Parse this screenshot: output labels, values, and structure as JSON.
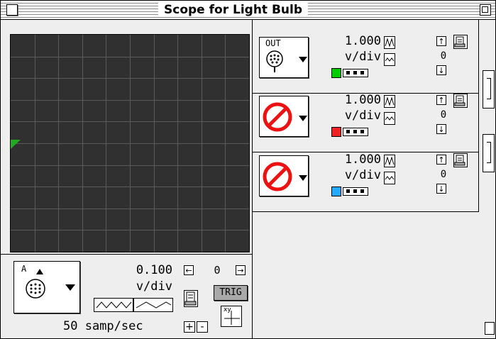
{
  "window": {
    "title": "Scope for Light Bulb"
  },
  "channels": [
    {
      "source_label": "OUT",
      "source_icon": "probe-icon",
      "volts_value": "1.000",
      "volts_unit": "v/div",
      "offset": "0",
      "color": "#00cc00"
    },
    {
      "source_label": "",
      "source_icon": "no-signal-icon",
      "volts_value": "1.000",
      "volts_unit": "v/div",
      "offset": "0",
      "color": "#ee2222"
    },
    {
      "source_label": "",
      "source_icon": "no-signal-icon",
      "volts_value": "1.000",
      "volts_unit": "v/div",
      "offset": "0",
      "color": "#22aaff"
    }
  ],
  "timebase": {
    "source_label": "A",
    "value": "0.100",
    "unit": "v/div",
    "offset": "0",
    "trig_label": "TRIG",
    "xy_label": "xy",
    "sample_rate": "50 samp/sec",
    "plus_label": "+",
    "minus_label": "-"
  },
  "scope": {
    "background": "#303030",
    "grid_color": "#5a5a5a",
    "marker_color": "#22aa22"
  }
}
